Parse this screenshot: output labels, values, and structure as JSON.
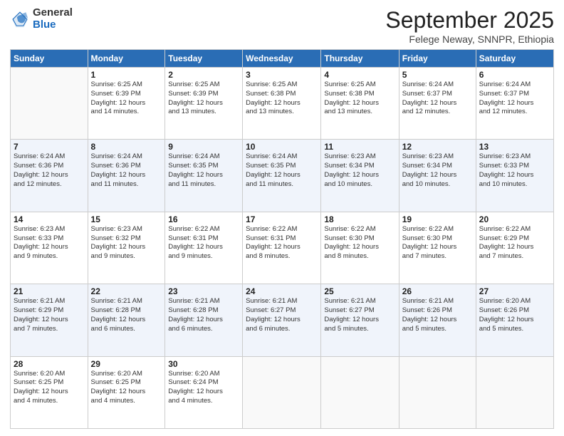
{
  "logo": {
    "general": "General",
    "blue": "Blue"
  },
  "title": "September 2025",
  "subtitle": "Felege Neway, SNNPR, Ethiopia",
  "days_of_week": [
    "Sunday",
    "Monday",
    "Tuesday",
    "Wednesday",
    "Thursday",
    "Friday",
    "Saturday"
  ],
  "weeks": [
    [
      {
        "num": "",
        "info": ""
      },
      {
        "num": "1",
        "info": "Sunrise: 6:25 AM\nSunset: 6:39 PM\nDaylight: 12 hours\nand 14 minutes."
      },
      {
        "num": "2",
        "info": "Sunrise: 6:25 AM\nSunset: 6:39 PM\nDaylight: 12 hours\nand 13 minutes."
      },
      {
        "num": "3",
        "info": "Sunrise: 6:25 AM\nSunset: 6:38 PM\nDaylight: 12 hours\nand 13 minutes."
      },
      {
        "num": "4",
        "info": "Sunrise: 6:25 AM\nSunset: 6:38 PM\nDaylight: 12 hours\nand 13 minutes."
      },
      {
        "num": "5",
        "info": "Sunrise: 6:24 AM\nSunset: 6:37 PM\nDaylight: 12 hours\nand 12 minutes."
      },
      {
        "num": "6",
        "info": "Sunrise: 6:24 AM\nSunset: 6:37 PM\nDaylight: 12 hours\nand 12 minutes."
      }
    ],
    [
      {
        "num": "7",
        "info": "Sunrise: 6:24 AM\nSunset: 6:36 PM\nDaylight: 12 hours\nand 12 minutes."
      },
      {
        "num": "8",
        "info": "Sunrise: 6:24 AM\nSunset: 6:36 PM\nDaylight: 12 hours\nand 11 minutes."
      },
      {
        "num": "9",
        "info": "Sunrise: 6:24 AM\nSunset: 6:35 PM\nDaylight: 12 hours\nand 11 minutes."
      },
      {
        "num": "10",
        "info": "Sunrise: 6:24 AM\nSunset: 6:35 PM\nDaylight: 12 hours\nand 11 minutes."
      },
      {
        "num": "11",
        "info": "Sunrise: 6:23 AM\nSunset: 6:34 PM\nDaylight: 12 hours\nand 10 minutes."
      },
      {
        "num": "12",
        "info": "Sunrise: 6:23 AM\nSunset: 6:34 PM\nDaylight: 12 hours\nand 10 minutes."
      },
      {
        "num": "13",
        "info": "Sunrise: 6:23 AM\nSunset: 6:33 PM\nDaylight: 12 hours\nand 10 minutes."
      }
    ],
    [
      {
        "num": "14",
        "info": "Sunrise: 6:23 AM\nSunset: 6:33 PM\nDaylight: 12 hours\nand 9 minutes."
      },
      {
        "num": "15",
        "info": "Sunrise: 6:23 AM\nSunset: 6:32 PM\nDaylight: 12 hours\nand 9 minutes."
      },
      {
        "num": "16",
        "info": "Sunrise: 6:22 AM\nSunset: 6:31 PM\nDaylight: 12 hours\nand 9 minutes."
      },
      {
        "num": "17",
        "info": "Sunrise: 6:22 AM\nSunset: 6:31 PM\nDaylight: 12 hours\nand 8 minutes."
      },
      {
        "num": "18",
        "info": "Sunrise: 6:22 AM\nSunset: 6:30 PM\nDaylight: 12 hours\nand 8 minutes."
      },
      {
        "num": "19",
        "info": "Sunrise: 6:22 AM\nSunset: 6:30 PM\nDaylight: 12 hours\nand 7 minutes."
      },
      {
        "num": "20",
        "info": "Sunrise: 6:22 AM\nSunset: 6:29 PM\nDaylight: 12 hours\nand 7 minutes."
      }
    ],
    [
      {
        "num": "21",
        "info": "Sunrise: 6:21 AM\nSunset: 6:29 PM\nDaylight: 12 hours\nand 7 minutes."
      },
      {
        "num": "22",
        "info": "Sunrise: 6:21 AM\nSunset: 6:28 PM\nDaylight: 12 hours\nand 6 minutes."
      },
      {
        "num": "23",
        "info": "Sunrise: 6:21 AM\nSunset: 6:28 PM\nDaylight: 12 hours\nand 6 minutes."
      },
      {
        "num": "24",
        "info": "Sunrise: 6:21 AM\nSunset: 6:27 PM\nDaylight: 12 hours\nand 6 minutes."
      },
      {
        "num": "25",
        "info": "Sunrise: 6:21 AM\nSunset: 6:27 PM\nDaylight: 12 hours\nand 5 minutes."
      },
      {
        "num": "26",
        "info": "Sunrise: 6:21 AM\nSunset: 6:26 PM\nDaylight: 12 hours\nand 5 minutes."
      },
      {
        "num": "27",
        "info": "Sunrise: 6:20 AM\nSunset: 6:26 PM\nDaylight: 12 hours\nand 5 minutes."
      }
    ],
    [
      {
        "num": "28",
        "info": "Sunrise: 6:20 AM\nSunset: 6:25 PM\nDaylight: 12 hours\nand 4 minutes."
      },
      {
        "num": "29",
        "info": "Sunrise: 6:20 AM\nSunset: 6:25 PM\nDaylight: 12 hours\nand 4 minutes."
      },
      {
        "num": "30",
        "info": "Sunrise: 6:20 AM\nSunset: 6:24 PM\nDaylight: 12 hours\nand 4 minutes."
      },
      {
        "num": "",
        "info": ""
      },
      {
        "num": "",
        "info": ""
      },
      {
        "num": "",
        "info": ""
      },
      {
        "num": "",
        "info": ""
      }
    ]
  ]
}
